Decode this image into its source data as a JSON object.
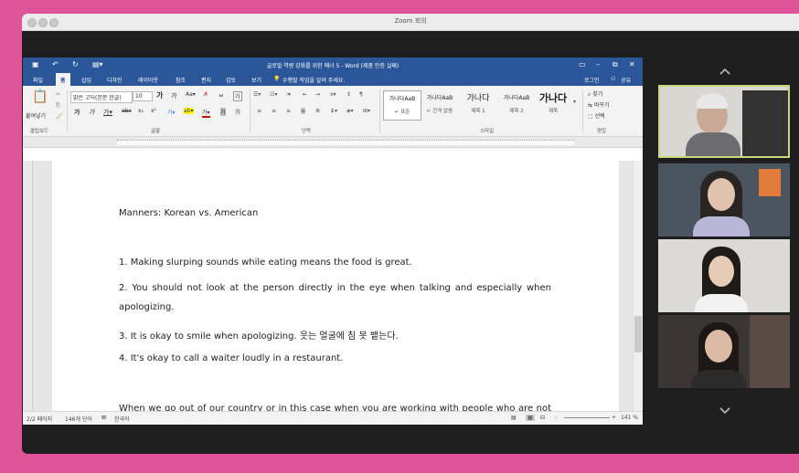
{
  "zoom": {
    "window_title": "Zoom 회의"
  },
  "word": {
    "title": "글로벌 역량 강화를 위한 매너 5 - Word (제품 인증 실패)",
    "tabs": [
      "파일",
      "홈",
      "삽입",
      "디자인",
      "레이아웃",
      "참조",
      "편지",
      "검토",
      "보기"
    ],
    "tell_me": "수행할 작업을 알려 주세요.",
    "sign_in": "로그인",
    "share": "공유",
    "ribbon": {
      "paste": "붙여넣기",
      "font_name": "맑은 고딕(본문 한글)",
      "font_size": "10",
      "font_ga": "가",
      "group_clipboard": "클립보드",
      "group_font": "글꼴",
      "group_paragraph": "단락",
      "group_styles": "스타일",
      "group_editing": "편집",
      "styles": [
        {
          "sample": "가나다AaB",
          "name": "↵ 표준"
        },
        {
          "sample": "가나다AaB",
          "name": "↵ 간격 없음"
        },
        {
          "sample": "가나다",
          "name": "제목 1"
        },
        {
          "sample": "가나다AaB",
          "name": "제목 2"
        },
        {
          "sample": "가나다",
          "name": "제목"
        }
      ],
      "find": "찾기",
      "replace": "바꾸기",
      "select": "선택"
    },
    "document": {
      "title_line": "Manners: Korean vs. American",
      "items": [
        "1. Making slurping sounds while eating means the food is great.",
        "2. You should not look at the person directly in the eye when talking and especially when",
        "apologizing.",
        "3. It is okay to smile when apologizing. 웃는 얼굴에 침 못 뱉는다.",
        "4. It's okay to call a waiter loudly in a restaurant."
      ],
      "last_line": "When we go out of our country or in this case when you are working with people who are not"
    },
    "status": {
      "page": "2/2 페이지",
      "words": "146개 단어",
      "language": "한국어",
      "zoom": "141 %"
    }
  },
  "colors": {
    "word_blue": "#2b579a",
    "background_pink": "#e0559a",
    "active_speaker_border": "#c6d87a"
  }
}
